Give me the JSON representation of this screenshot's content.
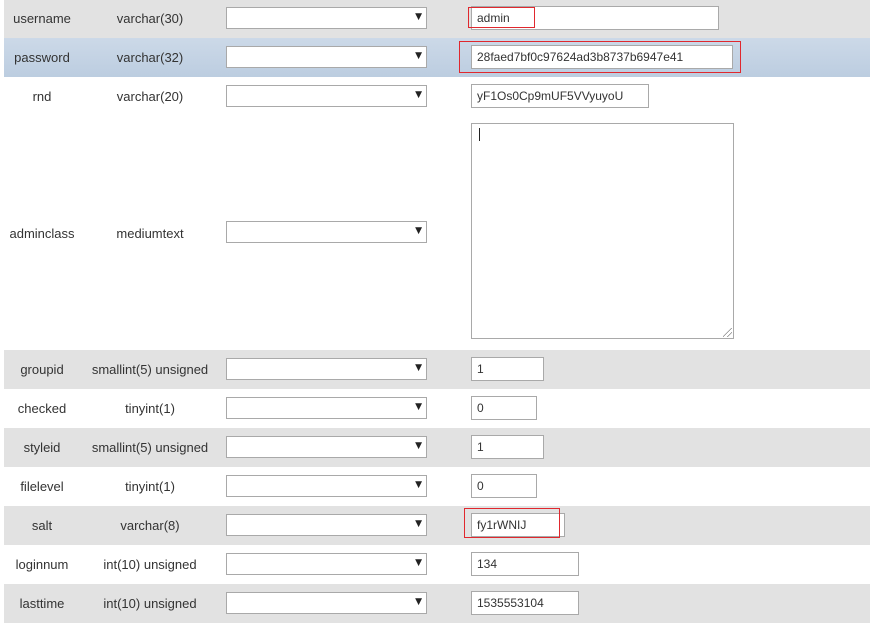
{
  "fields": [
    {
      "name": "username",
      "type": "varchar(30)",
      "value": "admin"
    },
    {
      "name": "password",
      "type": "varchar(32)",
      "value": "28faed7bf0c97624ad3b8737b6947e41"
    },
    {
      "name": "rnd",
      "type": "varchar(20)",
      "value": "yF1Os0Cp9mUF5VVyuyoU"
    },
    {
      "name": "adminclass",
      "type": "mediumtext",
      "value": ""
    },
    {
      "name": "groupid",
      "type": "smallint(5) unsigned",
      "value": "1"
    },
    {
      "name": "checked",
      "type": "tinyint(1)",
      "value": "0"
    },
    {
      "name": "styleid",
      "type": "smallint(5) unsigned",
      "value": "1"
    },
    {
      "name": "filelevel",
      "type": "tinyint(1)",
      "value": "0"
    },
    {
      "name": "salt",
      "type": "varchar(8)",
      "value": "fy1rWNIJ"
    },
    {
      "name": "loginnum",
      "type": "int(10) unsigned",
      "value": "134"
    },
    {
      "name": "lasttime",
      "type": "int(10) unsigned",
      "value": "1535553104"
    }
  ],
  "colors": {
    "row_grey": "#e2e2e2",
    "row_selected": "#c4d3e5",
    "highlight": "#e0282e"
  },
  "icons": {
    "select_arrow": "chevron-down-icon"
  },
  "highlighted_fields": [
    "username",
    "password",
    "salt"
  ]
}
